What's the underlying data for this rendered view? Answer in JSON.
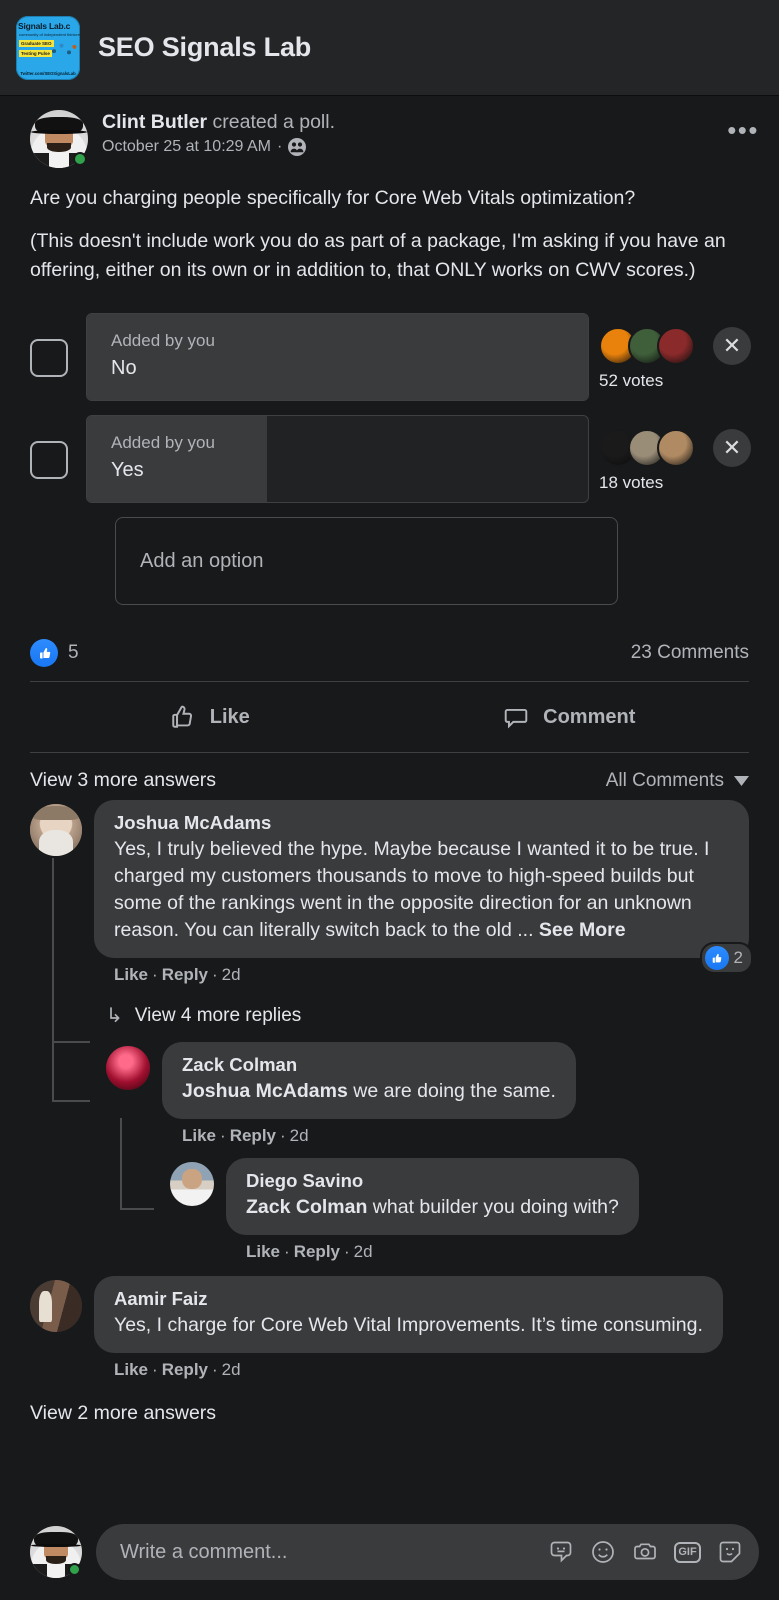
{
  "group": {
    "name": "SEO Signals Lab",
    "logo": {
      "top_text": "Signals Lab.c",
      "sub_text": "community of independent thinkers",
      "chip1": "Graduate SEO",
      "chip2": "Testing Pulse",
      "footer": "Twitter.com/SEOSignalsLab"
    }
  },
  "post": {
    "author": "Clint Butler",
    "action": "created a poll.",
    "timestamp": "October 25 at 10:29 AM",
    "audience_icon": "group-audience-icon",
    "menu_icon": "more-options-icon",
    "question": "Are you charging people specifically for Core Web Vitals optimization?",
    "details": "(This doesn't include work you do as part of a package, I'm asking if you have an offering, either on its own or in addition to,  that ONLY works on CWV scores.)"
  },
  "poll": {
    "options": [
      {
        "added_by": "Added by you",
        "label": "No",
        "votes_text": "52 votes",
        "votes": 52,
        "fill_percent": 100,
        "remove_icon": "close-icon",
        "voter_colors": [
          "#e8820c",
          "#3f5e3a",
          "#8a2a2a"
        ]
      },
      {
        "added_by": "Added by you",
        "label": "Yes",
        "votes_text": "18 votes",
        "votes": 18,
        "fill_percent": 36,
        "remove_icon": "close-icon",
        "voter_colors": [
          "#1a1a1a",
          "#9a8d78",
          "#b08a62"
        ]
      }
    ],
    "add_option_placeholder": "Add an option"
  },
  "reactions": {
    "like_icon": "thumbs-up-icon",
    "count": "5",
    "comments_count": "23 Comments"
  },
  "actions": {
    "like_label": "Like",
    "like_icon": "thumbs-up-outline-icon",
    "comment_label": "Comment",
    "comment_icon": "comment-bubble-icon"
  },
  "comments_header": {
    "view_more_answers": "View 3 more answers",
    "sort_label": "All Comments",
    "sort_icon": "chevron-down-icon"
  },
  "comments": [
    {
      "name": "Joshua McAdams",
      "text": "Yes, I truly believed the hype. Maybe because I wanted it to be true. I charged my customers thousands to move to high-speed builds but some of the rankings went in the opposite direction for an unknown reason. You can literally switch back to the old ... ",
      "see_more": "See More",
      "like": "Like",
      "reply": "Reply",
      "time": "2d",
      "reaction_count": "2",
      "reaction_icon": "thumbs-up-icon"
    },
    {
      "name": "Zack Colman",
      "mention": "Joshua McAdams",
      "text": " we are doing the same.",
      "like": "Like",
      "reply": "Reply",
      "time": "2d"
    },
    {
      "name": "Diego Savino",
      "mention": "Zack Colman",
      "text": " what builder you doing with?",
      "like": "Like",
      "reply": "Reply",
      "time": "2d"
    },
    {
      "name": "Aamir Faiz",
      "text": "Yes, I charge for Core Web Vital Improvements. It’s time consuming.",
      "like": "Like",
      "reply": "Reply",
      "time": "2d"
    }
  ],
  "view_replies_label": "View 4 more replies",
  "view_more_answers_bottom": "View 2 more answers",
  "composer": {
    "placeholder": "Write a comment...",
    "icons": [
      "sticker-avatar-icon",
      "emoji-icon",
      "camera-icon",
      "gif-icon",
      "sticker-icon"
    ],
    "gif_label": "GIF"
  },
  "colors": {
    "page_bg": "#18191a",
    "header_bg": "#242526",
    "bubble_bg": "#3a3b3c",
    "accent_blue": "#1877f2",
    "online_green": "#31a24c",
    "text_primary": "#e4e6eb",
    "text_secondary": "#b0b3b8"
  }
}
